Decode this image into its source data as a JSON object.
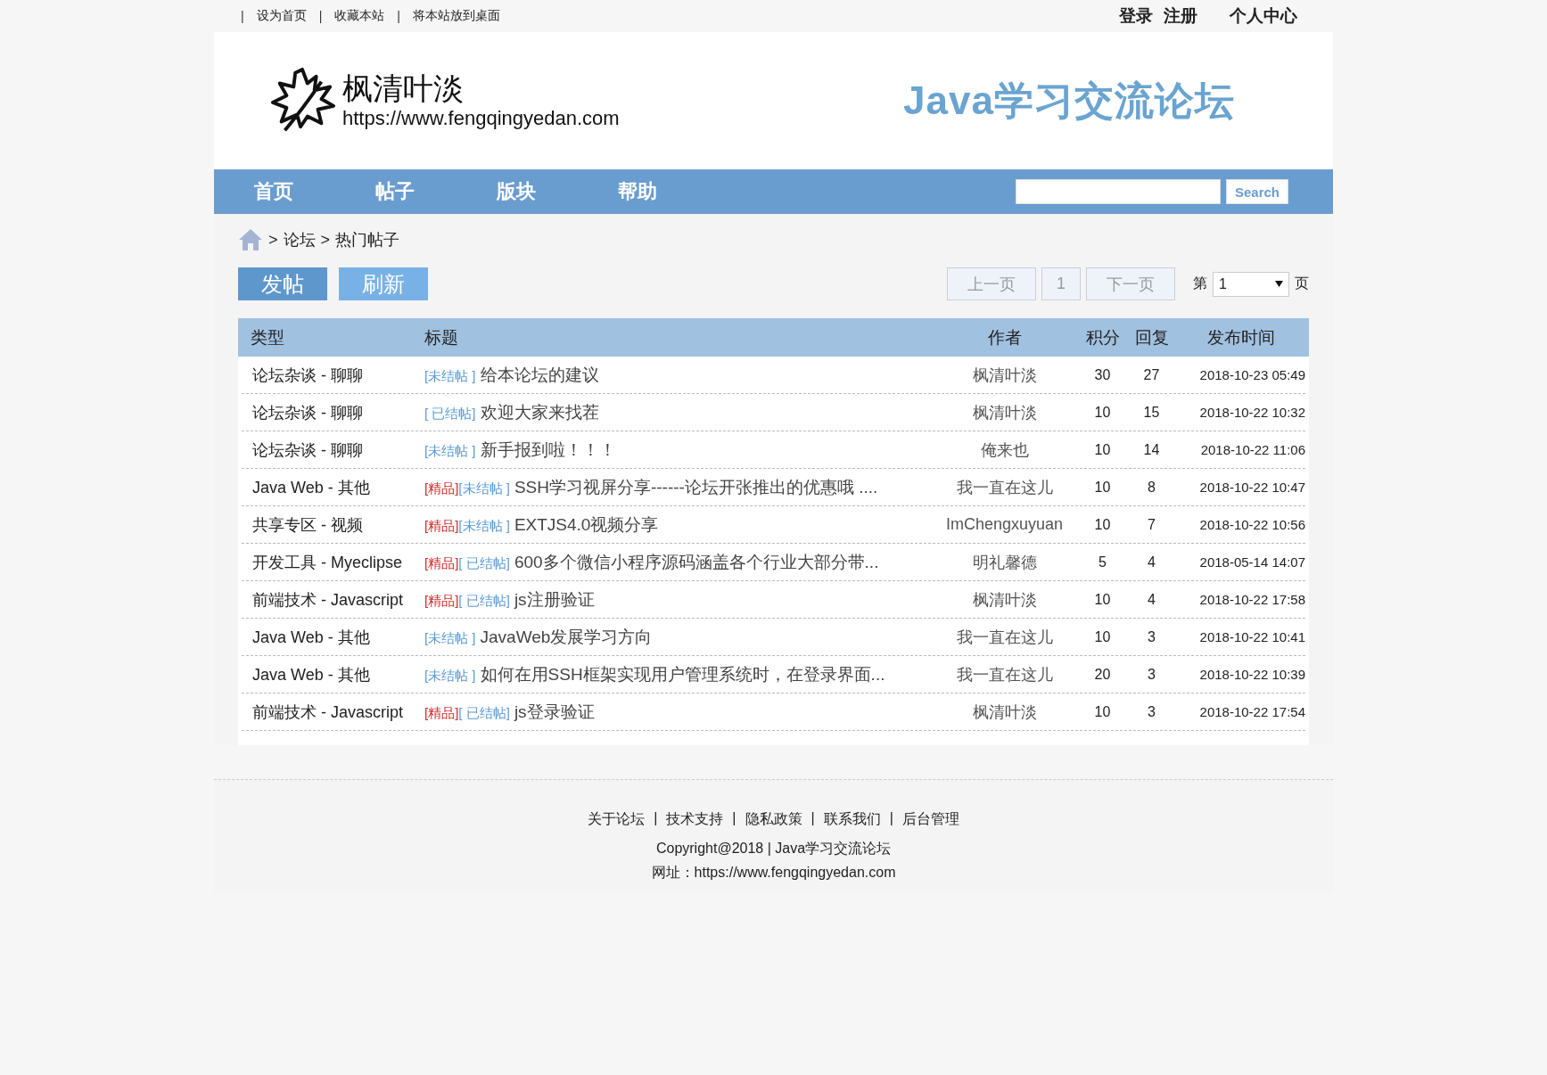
{
  "top_bar": {
    "links": [
      "设为首页",
      "收藏本站",
      "将本站放到桌面"
    ],
    "separator": "|",
    "account": [
      "登录",
      "注册"
    ],
    "user_center": "个人中心"
  },
  "header": {
    "site_name": "枫清叶淡",
    "site_url": "https://www.fengqingyedan.com",
    "slogan": "Java学习交流论坛"
  },
  "nav": {
    "items": [
      "首页",
      "帖子",
      "版块",
      "帮助"
    ],
    "search_button": "Search"
  },
  "breadcrumb": {
    "separator": ">",
    "items": [
      "论坛",
      "热门帖子"
    ]
  },
  "actions": [
    "发帖",
    "刷新"
  ],
  "pagination": {
    "prev": "上一页",
    "current": "1",
    "next": "下一页",
    "page_prefix": "第",
    "page_value": "1",
    "page_suffix": "页"
  },
  "table": {
    "columns": [
      "类型",
      "标题",
      "作者",
      "积分",
      "回复",
      "发布时间"
    ],
    "rows": [
      {
        "type": "论坛杂谈 - 聊聊",
        "tags": [
          {
            "kind": "open",
            "text": "[未结帖 ]"
          }
        ],
        "title": "给本论坛的建议",
        "author": "枫清叶淡",
        "score": "30",
        "replies": "27",
        "time": "2018-10-23 05:49"
      },
      {
        "type": "论坛杂谈 - 聊聊",
        "tags": [
          {
            "kind": "closed",
            "text": "[ 已结帖]"
          }
        ],
        "title": "欢迎大家来找茬",
        "author": "枫清叶淡",
        "score": "10",
        "replies": "15",
        "time": "2018-10-22 10:32"
      },
      {
        "type": "论坛杂谈 - 聊聊",
        "tags": [
          {
            "kind": "open",
            "text": "[未结帖 ]"
          }
        ],
        "title": "新手报到啦！！！",
        "author": "俺来也",
        "score": "10",
        "replies": "14",
        "time": "2018-10-22 11:06"
      },
      {
        "type": "Java Web - 其他",
        "tags": [
          {
            "kind": "featured",
            "text": "[精品]"
          },
          {
            "kind": "open",
            "text": "[未结帖 ]"
          }
        ],
        "title": "SSH学习视屏分享------论坛开张推出的优惠哦 ....",
        "author": "我一直在这儿",
        "score": "10",
        "replies": "8",
        "time": "2018-10-22 10:47"
      },
      {
        "type": "共享专区 - 视频",
        "tags": [
          {
            "kind": "featured",
            "text": "[精品]"
          },
          {
            "kind": "open",
            "text": "[未结帖 ]"
          }
        ],
        "title": "EXTJS4.0视频分享",
        "author": "ImChengxuyuan",
        "score": "10",
        "replies": "7",
        "time": "2018-10-22 10:56"
      },
      {
        "type": "开发工具 - Myeclipse",
        "tags": [
          {
            "kind": "featured",
            "text": "[精品]"
          },
          {
            "kind": "closed",
            "text": "[ 已结帖]"
          }
        ],
        "title": "600多个微信小程序源码涵盖各个行业大部分带...",
        "author": "明礼馨德",
        "score": "5",
        "replies": "4",
        "time": "2018-05-14 14:07"
      },
      {
        "type": "前端技术 - Javascript",
        "tags": [
          {
            "kind": "featured",
            "text": "[精品]"
          },
          {
            "kind": "closed",
            "text": "[ 已结帖]"
          }
        ],
        "title": "js注册验证",
        "author": "枫清叶淡",
        "score": "10",
        "replies": "4",
        "time": "2018-10-22 17:58"
      },
      {
        "type": "Java Web - 其他",
        "tags": [
          {
            "kind": "open",
            "text": "[未结帖 ]"
          }
        ],
        "title": "JavaWeb发展学习方向",
        "author": "我一直在这儿",
        "score": "10",
        "replies": "3",
        "time": "2018-10-22 10:41"
      },
      {
        "type": "Java Web - 其他",
        "tags": [
          {
            "kind": "open",
            "text": "[未结帖 ]"
          }
        ],
        "title": "如何在用SSH框架实现用户管理系统时，在登录界面...",
        "author": "我一直在这儿",
        "score": "20",
        "replies": "3",
        "time": "2018-10-22 10:39"
      },
      {
        "type": "前端技术 - Javascript",
        "tags": [
          {
            "kind": "featured",
            "text": "[精品]"
          },
          {
            "kind": "closed",
            "text": "[ 已结帖]"
          }
        ],
        "title": "js登录验证",
        "author": "枫清叶淡",
        "score": "10",
        "replies": "3",
        "time": "2018-10-22 17:54"
      }
    ]
  },
  "footer": {
    "links": [
      "关于论坛",
      "技术支持",
      "隐私政策",
      "联系我们",
      "后台管理"
    ],
    "separator": "|",
    "copyright": "Copyright@2018 | Java学习交流论坛",
    "address": "网址：https://www.fengqingyedan.com"
  }
}
